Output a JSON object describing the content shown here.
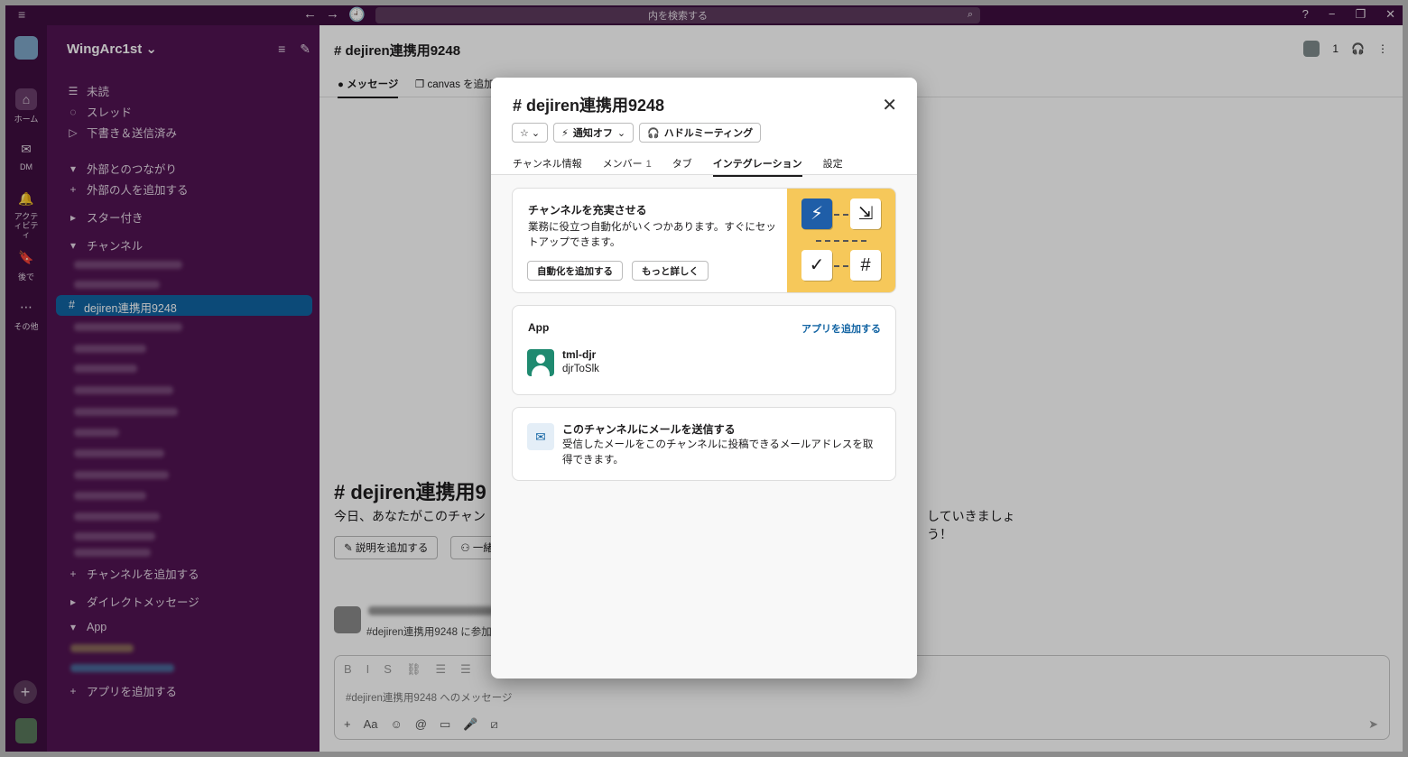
{
  "titlebar": {
    "menu_icon": "≡",
    "back": "←",
    "forward": "→",
    "history": "🕘",
    "search_placeholder": "内を検索する",
    "search_icon": "⌕",
    "help": "?",
    "minimize": "−",
    "restore": "❐",
    "close": "✕"
  },
  "rail": {
    "items": [
      {
        "icon": "⌂",
        "label": "ホーム"
      },
      {
        "icon": "✉",
        "label": "DM"
      },
      {
        "icon": "🔔",
        "label": "アクティビティ"
      },
      {
        "icon": "🔖",
        "label": "後で"
      },
      {
        "icon": "⋯",
        "label": "その他"
      }
    ],
    "add": "+"
  },
  "sidebar": {
    "workspace": "WingArc1st",
    "workspace_caret": "⌄",
    "filter_icon": "≡",
    "compose_icon": "✎",
    "nav": [
      {
        "icon": "☰",
        "label": "未読"
      },
      {
        "icon": "◌",
        "label": "スレッド"
      },
      {
        "icon": "▷",
        "label": "下書き＆送信済み"
      }
    ],
    "sections": [
      {
        "caret": "▾",
        "label": "外部とのつながり"
      },
      {
        "caret": "+",
        "label": "外部の人を追加する"
      },
      {
        "caret": "▸",
        "label": "スター付き"
      },
      {
        "caret": "▾",
        "label": "チャンネル"
      }
    ],
    "active_channel": {
      "hash": "#",
      "name": "dejiren連携用9248"
    },
    "bottom": [
      {
        "caret": "+",
        "label": "チャンネルを追加する"
      },
      {
        "caret": "▸",
        "label": "ダイレクトメッセージ"
      },
      {
        "caret": "▾",
        "label": "App"
      },
      {
        "caret": "+",
        "label": "アプリを追加する"
      }
    ]
  },
  "channel": {
    "title": "# dejiren連携用9248",
    "tabs": [
      {
        "icon": "●",
        "label": "メッセージ"
      },
      {
        "icon": "❐",
        "label": "canvas を追加する"
      }
    ],
    "member_count": "1",
    "headphone_icon": "🎧",
    "kebab": "⋮",
    "hero_title": "# dejiren連携用9",
    "hero_desc_left": "今日、あなたがこのチャン",
    "hero_desc_right": "していきましょう！",
    "hero_btn1": "✎ 説明を追加する",
    "hero_btn2": "⚇ 一緒",
    "message_text": "#dejiren連携用9248 に参加",
    "composer_placeholder": "#dejiren連携用9248 へのメッセージ",
    "composer_fmt": [
      "B",
      "I",
      "S",
      "⛓",
      "☰",
      "☰"
    ],
    "composer_tools": [
      "+",
      "Aa",
      "☺",
      "@",
      "▭",
      "🎤",
      "⧄"
    ],
    "send": "➤"
  },
  "modal": {
    "title": "# dejiren連携用9248",
    "close": "✕",
    "star_button": "☆ ⌄",
    "notify_button": "通知オフ",
    "notify_icon": "⚡",
    "notify_caret": "⌄",
    "huddle_button": "ハドルミーティング",
    "huddle_icon": "🎧",
    "tabs": {
      "info": "チャンネル情報",
      "members": "メンバー",
      "members_count": "1",
      "tab": "タブ",
      "integration": "インテグレーション",
      "settings": "設定"
    },
    "enrich": {
      "title": "チャンネルを充実させる",
      "desc": "業務に役立つ自動化がいくつかあります。すぐにセットアップできます。",
      "add_automation": "自動化を追加する",
      "learn_more": "もっと詳しく",
      "illus_icons": [
        "⚡",
        "⇲",
        "✓",
        "#"
      ]
    },
    "apps": {
      "title": "App",
      "add_link": "アプリを追加する",
      "app_name": "tml-djr",
      "app_sub": "djrToSlk"
    },
    "email": {
      "icon": "✉",
      "title": "このチャンネルにメールを送信する",
      "desc": "受信したメールをこのチャンネルに投稿できるメールアドレスを取得できます。"
    }
  }
}
